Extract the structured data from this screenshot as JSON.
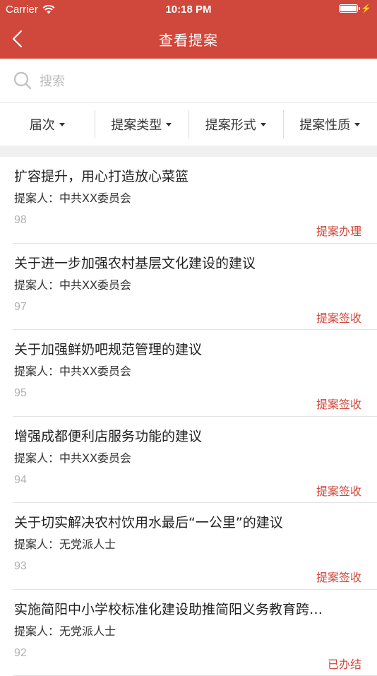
{
  "status_bar": {
    "carrier": "Carrier",
    "time": "10:18 PM",
    "battery_level": 1.0
  },
  "nav": {
    "title": "查看提案",
    "back_icon": "chevron-left-icon"
  },
  "search": {
    "placeholder": "搜索",
    "value": ""
  },
  "filters": [
    {
      "label": "届次"
    },
    {
      "label": "提案类型"
    },
    {
      "label": "提案形式"
    },
    {
      "label": "提案性质"
    }
  ],
  "colors": {
    "primary": "#d0473b",
    "divider": "#e3e3e3",
    "muted": "#b0b0b0"
  },
  "items": [
    {
      "title": "扩容提升，用心打造放心菜篮",
      "proposer": "提案人：中共XX委员会",
      "number": "98",
      "status": "提案办理"
    },
    {
      "title": "关于进一步加强农村基层文化建设的建议",
      "proposer": "提案人：中共XX委员会",
      "number": "97",
      "status": "提案签收"
    },
    {
      "title": "关于加强鲜奶吧规范管理的建议",
      "proposer": "提案人：中共XX委员会",
      "number": "95",
      "status": "提案签收"
    },
    {
      "title": "增强成都便利店服务功能的建议",
      "proposer": "提案人：中共XX委员会",
      "number": "94",
      "status": "提案签收"
    },
    {
      "title": "关于切实解决农村饮用水最后“一公里”的建议",
      "proposer": "提案人：无党派人士",
      "number": "93",
      "status": "提案签收"
    },
    {
      "title": "实施简阳中小学校标准化建设助推简阳义务教育跨…",
      "proposer": "提案人：无党派人士",
      "number": "92",
      "status": "已办结"
    }
  ]
}
